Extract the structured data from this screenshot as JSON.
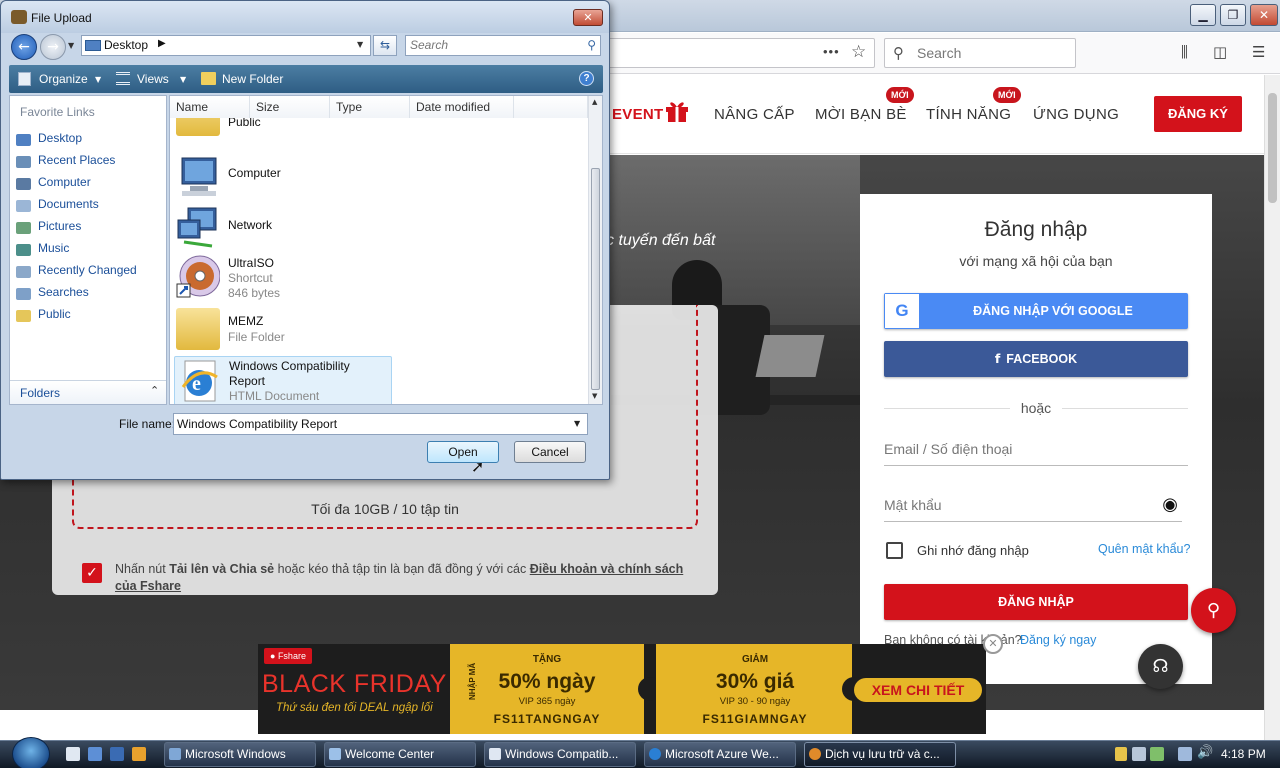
{
  "browser": {
    "search_placeholder": "Search",
    "url_more": "•••",
    "bookmark_star": "☆"
  },
  "site": {
    "nav": {
      "event": "EVENT",
      "upgrade": "NÂNG CẤP",
      "invite": "MỜI BẠN BÈ",
      "features": "TÍNH NĂNG",
      "apps": "ỨNG DỤNG",
      "badge_new": "MỚI",
      "register": "ĐĂNG KÝ"
    },
    "hero_text": "c tuyến đến bất",
    "upload": {
      "limit": "Tối đa 10GB / 10 tập tin",
      "terms_prefix": "Nhấn nút ",
      "terms_bold": "Tải lên và Chia sẻ",
      "terms_mid": " hoặc kéo thả tập tin là bạn đã đồng ý với các ",
      "terms_link": "Điều khoản và chính sách của Fshare"
    },
    "login": {
      "title": "Đăng nhập",
      "subtitle": "với mạng xã hội của bạn",
      "google": "ĐĂNG NHẬP VỚI GOOGLE",
      "facebook": "FACEBOOK",
      "or": "hoặc",
      "email_placeholder": "Email / Số điện thoại",
      "password_placeholder": "Mật khẩu",
      "remember": "Ghi nhớ đăng nhập",
      "forgot": "Quên mật khẩu?",
      "submit": "ĐĂNG NHẬP",
      "no_account": "Bạn không có tài khoản?",
      "signup": "Đăng ký ngay"
    },
    "banner": {
      "brand": "Fshare",
      "headline": "BLACK FRIDAY",
      "tagline": "Thứ sáu đen tối DEAL ngập lối",
      "t1_top": "TẶNG",
      "t1_main": "50% ngày",
      "t1_sub": "VIP 365 ngày",
      "t1_code": "FS11TANGNGAY",
      "t2_top": "GIẢM",
      "t2_main": "30% giá",
      "t2_sub": "VIP 30 - 90 ngày",
      "t2_code": "FS11GIAMNGAY",
      "side_label": "NHẬP MÃ",
      "cta": "XEM CHI TIẾT"
    }
  },
  "dialog": {
    "title": "File Upload",
    "location": "Desktop",
    "search_placeholder": "Search",
    "toolbar": {
      "organize": "Organize",
      "views": "Views",
      "new_folder": "New Folder"
    },
    "favorites_header": "Favorite Links",
    "favorites": [
      "Desktop",
      "Recent Places",
      "Computer",
      "Documents",
      "Pictures",
      "Music",
      "Recently Changed",
      "Searches",
      "Public"
    ],
    "folders_label": "Folders",
    "columns": [
      "Name",
      "Size",
      "Type",
      "Date modified"
    ],
    "files": [
      {
        "name": "Public",
        "sub": ""
      },
      {
        "name": "Computer",
        "sub": ""
      },
      {
        "name": "Network",
        "sub": ""
      },
      {
        "name": "UltraISO",
        "sub": "Shortcut",
        "sub2": "846 bytes"
      },
      {
        "name": "MEMZ",
        "sub": "File Folder"
      },
      {
        "name": "Windows Compatibility",
        "name2": "Report",
        "sub": "HTML Document"
      }
    ],
    "filename_label": "File name:",
    "filename_value": "Windows Compatibility Report",
    "open": "Open",
    "cancel": "Cancel"
  },
  "taskbar": {
    "items": [
      "Microsoft Windows",
      "Welcome Center",
      "Windows Compatib...",
      "Microsoft Azure We...",
      "Dịch vụ lưu trữ và c..."
    ],
    "clock": "4:18 PM"
  },
  "colors": {
    "brand_red": "#d3121b",
    "google_blue": "#4a8af4",
    "facebook_blue": "#3b5998",
    "ticket_gold": "#e6b628"
  }
}
